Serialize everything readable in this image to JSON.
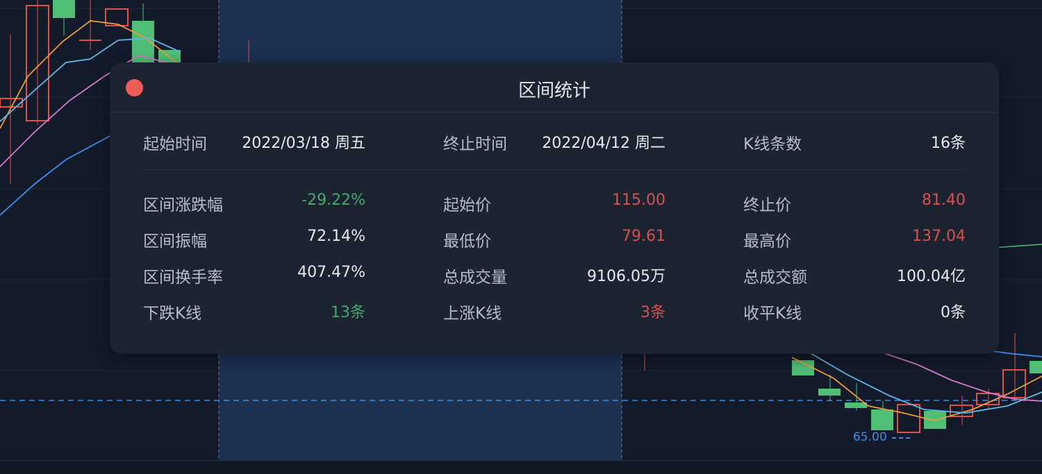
{
  "chart": {
    "price_line_label": "65.00",
    "colors": {
      "up": "#e0514c",
      "down": "#4fbf76",
      "ma5": "#f19b3c",
      "ma10": "#5fb7ea",
      "ma20": "#d57ad0",
      "ma60": "#3f8ef0",
      "selection": "#1c3152"
    }
  },
  "modal": {
    "title": "区间统计",
    "close_icon": "close-dot-icon",
    "header_row": [
      {
        "label": "起始时间",
        "value": "2022/03/18 周五"
      },
      {
        "label": "终止时间",
        "value": "2022/04/12 周二"
      },
      {
        "label": "K线条数",
        "value": "16条"
      }
    ],
    "rows": [
      [
        {
          "label": "区间涨跌幅",
          "value": "-29.22%",
          "color": "green"
        },
        {
          "label": "起始价",
          "value": "115.00",
          "color": "red"
        },
        {
          "label": "终止价",
          "value": "81.40",
          "color": "red"
        }
      ],
      [
        {
          "label": "区间振幅",
          "value": "72.14%",
          "color": "white"
        },
        {
          "label": "最低价",
          "value": "79.61",
          "color": "red"
        },
        {
          "label": "最高价",
          "value": "137.04",
          "color": "red"
        }
      ],
      [
        {
          "label": "区间换手率",
          "value": "407.47%",
          "color": "white"
        },
        {
          "label": "总成交量",
          "value": "9106.05万",
          "color": "white"
        },
        {
          "label": "总成交额",
          "value": "100.04亿",
          "color": "white"
        }
      ],
      [
        {
          "label": "下跌K线",
          "value": "13条",
          "color": "green"
        },
        {
          "label": "上涨K线",
          "value": "3条",
          "color": "red"
        },
        {
          "label": "收平K线",
          "value": "0条",
          "color": "white"
        }
      ]
    ]
  }
}
